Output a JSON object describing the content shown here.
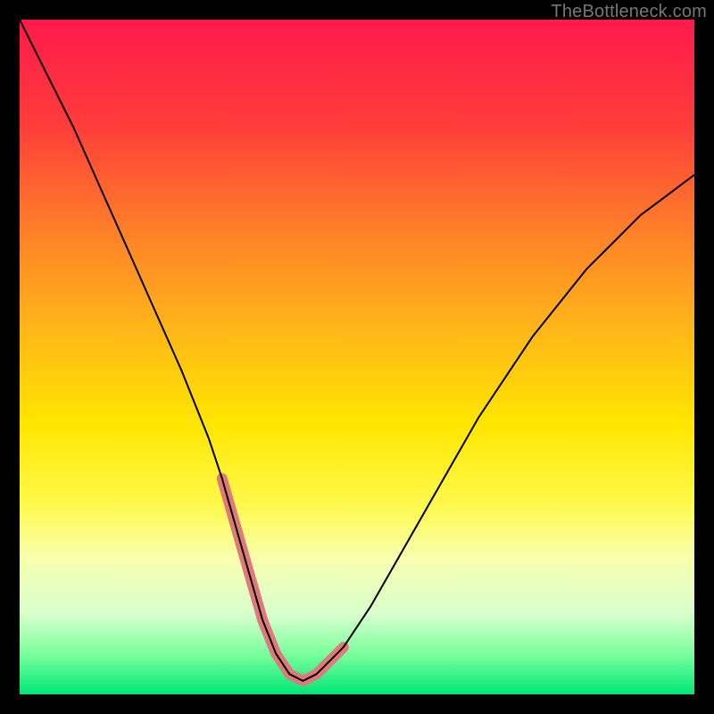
{
  "watermark": "TheBottleneck.com",
  "chart_data": {
    "type": "line",
    "title": "",
    "xlabel": "",
    "ylabel": "",
    "xlim": [
      0,
      100
    ],
    "ylim": [
      0,
      100
    ],
    "grid": false,
    "legend": false,
    "background": {
      "type": "vertical-gradient",
      "stops": [
        {
          "pos": 0.0,
          "color": "#ff1a4b"
        },
        {
          "pos": 0.15,
          "color": "#ff3b3b"
        },
        {
          "pos": 0.3,
          "color": "#ff7a2a"
        },
        {
          "pos": 0.45,
          "color": "#ffb31a"
        },
        {
          "pos": 0.6,
          "color": "#ffe600"
        },
        {
          "pos": 0.72,
          "color": "#fff94d"
        },
        {
          "pos": 0.8,
          "color": "#f7ffb0"
        },
        {
          "pos": 0.88,
          "color": "#d9ffcc"
        },
        {
          "pos": 0.94,
          "color": "#7aff9e"
        },
        {
          "pos": 1.0,
          "color": "#00e676"
        }
      ]
    },
    "series": [
      {
        "name": "bottleneck-curve",
        "color": "#000000",
        "width": 2,
        "x": [
          0,
          4,
          8,
          12,
          16,
          20,
          24,
          28,
          30,
          32,
          34,
          36,
          38,
          40,
          42,
          44,
          48,
          52,
          56,
          60,
          64,
          68,
          72,
          76,
          80,
          84,
          88,
          92,
          96,
          100
        ],
        "y": [
          100,
          92,
          84,
          75,
          66,
          57,
          48,
          38,
          32,
          25,
          18,
          11,
          6,
          3,
          2,
          3,
          7,
          13,
          20,
          27,
          34,
          41,
          47,
          53,
          58,
          63,
          67,
          71,
          74,
          77
        ]
      },
      {
        "name": "highlight-left",
        "color": "#e07a7a",
        "width": 12,
        "linecap": "round",
        "x": [
          30,
          32,
          34,
          36
        ],
        "y": [
          32,
          25,
          18,
          11
        ]
      },
      {
        "name": "highlight-bottom",
        "color": "#e07a7a",
        "width": 12,
        "linecap": "round",
        "x": [
          36,
          38,
          40,
          42,
          44
        ],
        "y": [
          11,
          6,
          3,
          2,
          3
        ]
      },
      {
        "name": "highlight-right",
        "color": "#e07a7a",
        "width": 12,
        "linecap": "round",
        "x": [
          44,
          46,
          48
        ],
        "y": [
          3,
          5,
          7
        ]
      }
    ]
  }
}
